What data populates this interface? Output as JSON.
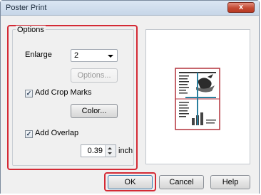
{
  "window": {
    "title": "Poster Print",
    "close_glyph": "x"
  },
  "options": {
    "group_title": "Options",
    "enlarge_label": "Enlarge",
    "enlarge_value": "2",
    "options_button": "Options...",
    "crop_marks": {
      "label": "Add Crop Marks",
      "checked": true
    },
    "color_button": "Color...",
    "overlap": {
      "label": "Add Overlap",
      "checked": true
    },
    "overlap_value": "0.39",
    "overlap_unit": "inch"
  },
  "footer": {
    "ok": "OK",
    "cancel": "Cancel",
    "help": "Help"
  },
  "colors": {
    "highlight": "#d42a35",
    "preview_border": "#b3323c",
    "split_line": "#2a7f9e"
  }
}
